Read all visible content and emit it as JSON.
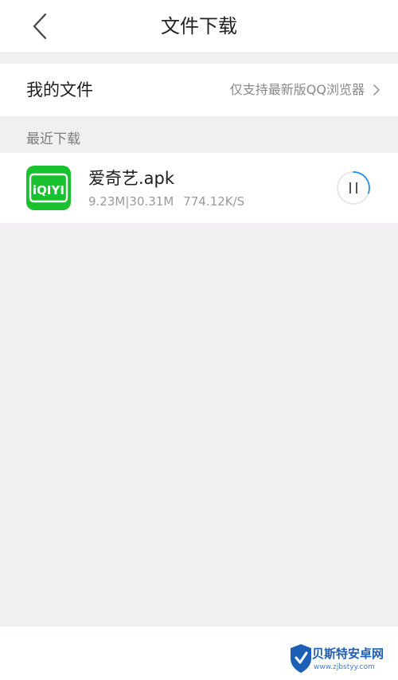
{
  "navbar": {
    "title": "文件下载",
    "back_icon": "chevron-left-icon"
  },
  "my_files": {
    "label": "我的文件",
    "hint": "仅支持最新版QQ浏览器",
    "chevron_icon": "chevron-right-icon"
  },
  "recent_downloads": {
    "header": "最近下载",
    "items": [
      {
        "icon": "iqiyi-app-icon",
        "icon_text": "iQIYI",
        "name": "爱奇艺.apk",
        "downloaded": "9.23M",
        "separator": "|",
        "total": "30.31M",
        "speed": "774.12K/S",
        "progress": 0.3045,
        "status": "downloading",
        "action_icon": "pause-icon"
      }
    ]
  },
  "watermark": {
    "name": "贝斯特安卓网",
    "url": "www.zjbstyy.com"
  },
  "colors": {
    "background": "#f1eff2",
    "surface": "#ffffff",
    "iqiyi_green": "#19c12f",
    "progress_blue": "#1e8fe8",
    "watermark_blue": "#1d5fb7"
  }
}
